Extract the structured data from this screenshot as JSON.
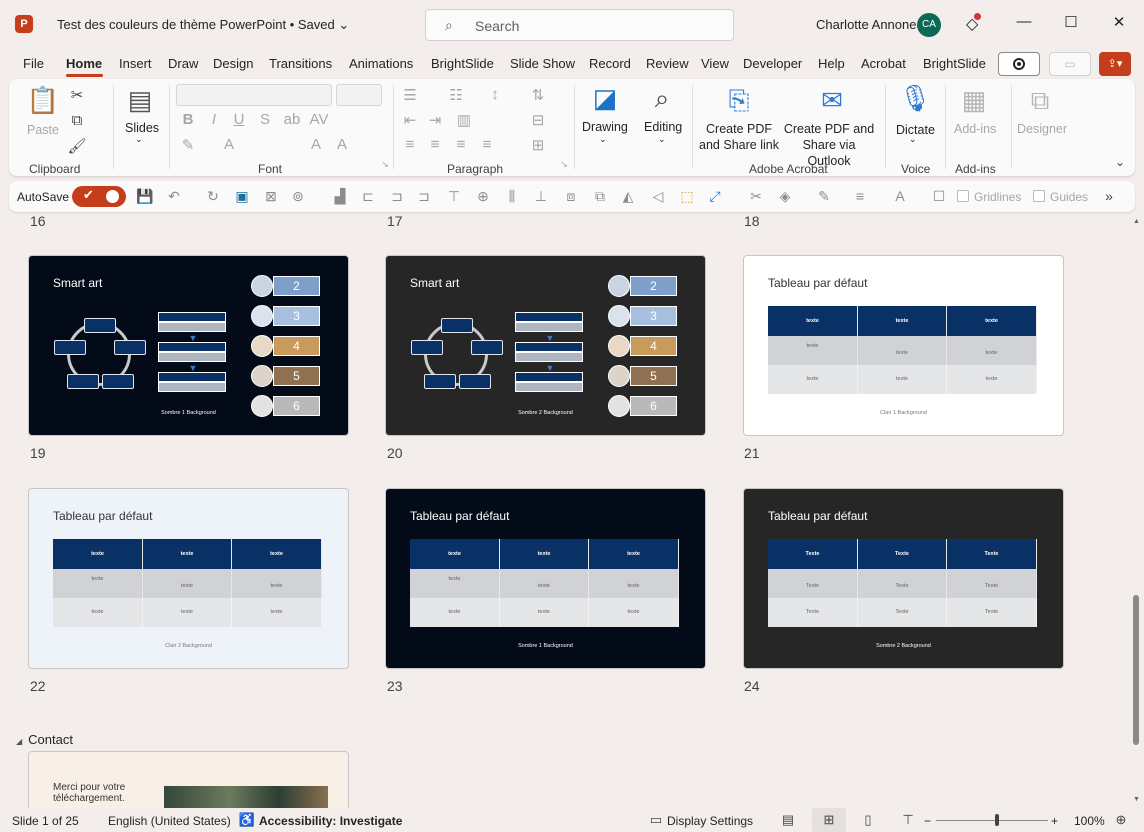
{
  "titlebar": {
    "app_logo": "P",
    "doc_title": "Test des couleurs de thème PowerPoint",
    "saved_status": "Saved",
    "search_placeholder": "Search",
    "user_name": "Charlotte Annone",
    "user_initials": "CA",
    "premium_icon": "diamond-icon"
  },
  "menu": [
    "File",
    "Home",
    "Insert",
    "Draw",
    "Design",
    "Transitions",
    "Animations",
    "BrightSlide",
    "Slide Show",
    "Record",
    "Review",
    "View",
    "Developer",
    "Help",
    "Acrobat",
    "BrightSlide"
  ],
  "ribbon": {
    "clipboard": {
      "paste": "Paste",
      "label": "Clipboard"
    },
    "slides": {
      "label": "Slides"
    },
    "font": {
      "label": "Font"
    },
    "paragraph": {
      "label": "Paragraph"
    },
    "drawing": {
      "label": "Drawing"
    },
    "editing": {
      "label": "Editing"
    },
    "acrobat": {
      "create_share_link": "Create PDF and Share link",
      "create_share_outlook": "Create PDF and Share via Outlook",
      "label": "Adobe Acrobat"
    },
    "voice": {
      "dictate": "Dictate",
      "label": "Voice"
    },
    "addins": {
      "addins": "Add-ins",
      "label": "Add-ins"
    },
    "designer": {
      "label": "Designer"
    }
  },
  "qat": {
    "autosave": "AutoSave",
    "gridlines": "Gridlines",
    "guides": "Guides"
  },
  "slides": {
    "top_numbers": [
      "16",
      "17",
      "18"
    ],
    "row1": [
      {
        "num": "19",
        "title": "Smart art",
        "footer": "Sombre 1 Background",
        "levels": [
          "2",
          "3",
          "4",
          "5",
          "6"
        ]
      },
      {
        "num": "20",
        "title": "Smart art",
        "footer": "Sombre 2 Background",
        "levels": [
          "2",
          "3",
          "4",
          "5",
          "6"
        ]
      },
      {
        "num": "21",
        "title": "Tableau par défaut",
        "footer": "Clair 1 Background",
        "cell": "texte"
      }
    ],
    "row2": [
      {
        "num": "22",
        "title": "Tableau par défaut",
        "footer": "Clair 2 Background",
        "cell": "texte"
      },
      {
        "num": "23",
        "title": "Tableau par défaut",
        "footer": "Sombre 1 Background",
        "cell": "texte"
      },
      {
        "num": "24",
        "title": "Tableau par défaut",
        "footer": "Sombre 2 Background",
        "cell": "Texte"
      }
    ],
    "section_name": "Contact",
    "contact_text": "Merci pour votre téléchargement."
  },
  "status": {
    "slide_count": "Slide 1 of 25",
    "language": "English (United States)",
    "accessibility": "Accessibility: Investigate",
    "display_settings": "Display Settings",
    "zoom": "100%"
  },
  "colors": {
    "accent": "#c43e1c",
    "navy": "#0a3166",
    "level_2": "#7d9fc9",
    "level_3": "#a8c0e0",
    "level_4": "#c89b5d",
    "level_5": "#8f7152",
    "level_6": "#b9b9b9"
  }
}
